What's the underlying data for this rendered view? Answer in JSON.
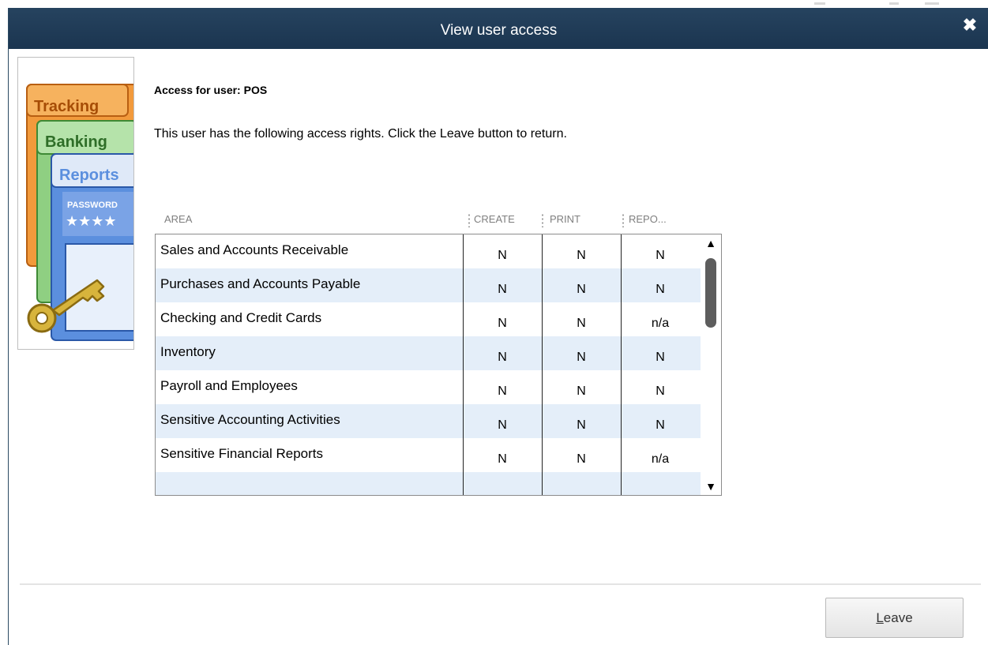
{
  "window": {
    "title": "View user access",
    "close_glyph": "✖"
  },
  "illustration": {
    "tab1": "Tracking",
    "tab2": "Banking",
    "tab3": "Reports",
    "password_label": "PASSWORD",
    "password_stars": "★★★★",
    "colors": {
      "tab1": "#f29a3c",
      "tab2": "#8fcf82",
      "tab3": "#5b8fde",
      "key": "#d7b43c"
    }
  },
  "access": {
    "title": "Access for user: POS",
    "description": "This user has the following access rights.  Click the Leave button to return."
  },
  "grid": {
    "columns": [
      "AREA",
      "CREATE",
      "PRINT",
      "REPO..."
    ],
    "rows": [
      {
        "area": "Sales and Accounts Receivable",
        "create": "N",
        "print": "N",
        "report": "N"
      },
      {
        "area": "Purchases and Accounts Payable",
        "create": "N",
        "print": "N",
        "report": "N"
      },
      {
        "area": "Checking and Credit Cards",
        "create": "N",
        "print": "N",
        "report": "n/a"
      },
      {
        "area": "Inventory",
        "create": "N",
        "print": "N",
        "report": "N"
      },
      {
        "area": "Payroll and Employees",
        "create": "N",
        "print": "N",
        "report": "N"
      },
      {
        "area": "Sensitive Accounting Activities",
        "create": "N",
        "print": "N",
        "report": "N"
      },
      {
        "area": "Sensitive Financial Reports",
        "create": "N",
        "print": "N",
        "report": "n/a"
      }
    ],
    "scroll_up_glyph": "▲",
    "scroll_down_glyph": "▼"
  },
  "footer": {
    "leave_mnemonic": "L",
    "leave_rest": "eave"
  }
}
